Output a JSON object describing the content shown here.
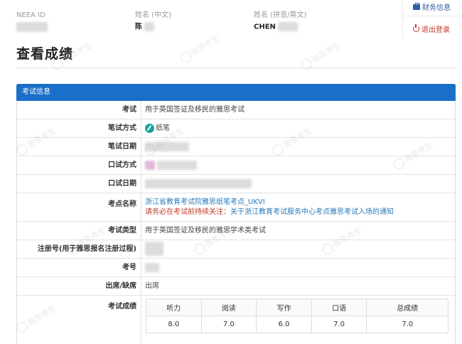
{
  "header": {
    "neea_id_label": "NEEA ID",
    "name_cn_label": "姓名 (中文)",
    "name_cn_value": "陈",
    "name_en_label": "姓名 (拼音/英文)",
    "name_en_value": "CHEN"
  },
  "nav": {
    "finance_label": "财务信息",
    "logout_label": "退出登录"
  },
  "page_title": "查看成绩",
  "panel": {
    "title": "考试信息",
    "rows": {
      "exam": {
        "label": "考试",
        "value": "用于英国签证及移民的雅思考试"
      },
      "written_method": {
        "label": "笔试方式",
        "value": "纸笔"
      },
      "written_date": {
        "label": "笔试日期"
      },
      "oral_method": {
        "label": "口试方式"
      },
      "oral_date": {
        "label": "口试日期"
      },
      "test_center": {
        "label": "考点名称",
        "name": "浙江省教育考试院雅思纸笔考点_UKVI",
        "notice_prefix": "请务必在考试前持续关注：",
        "notice_link": "关于浙江教育考试服务中心考点雅思考试入场的通知"
      },
      "exam_type": {
        "label": "考试类型",
        "value": "用于英国签证及移民的雅思学术类考试"
      },
      "reg_no": {
        "label": "注册号(用于雅思报名注册过程)"
      },
      "candidate_no": {
        "label": "考号"
      },
      "attendance": {
        "label": "出席/缺席",
        "value": "出席"
      },
      "scores": {
        "label": "考试成绩",
        "headers": [
          "听力",
          "阅读",
          "写作",
          "口语",
          "总成绩"
        ],
        "values": [
          "8.0",
          "7.0",
          "6.0",
          "7.0",
          "7.0"
        ]
      }
    }
  },
  "watermark_text": "雅思考生"
}
